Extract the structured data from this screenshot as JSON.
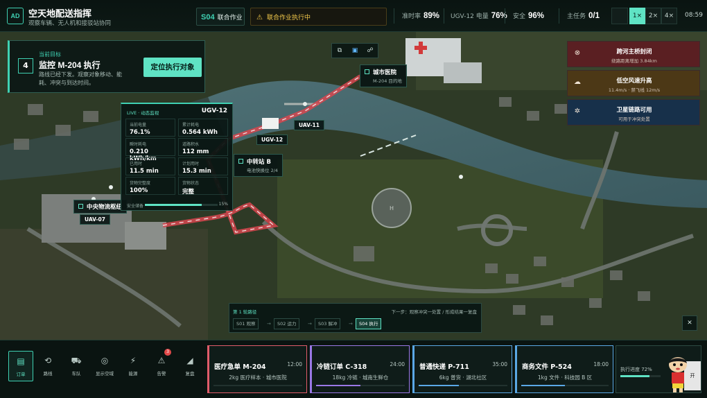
{
  "header": {
    "logo": "AD",
    "title": "空天地配送指挥",
    "subtitle": "观察车辆、无人机和接驳站协同",
    "stage_code": "S04",
    "stage_name": "联合作业",
    "alert_text": "联合作业执行中",
    "stats": [
      {
        "label": "准时率",
        "value": "89%"
      },
      {
        "label": "UGV-12 电量",
        "value": "76%"
      },
      {
        "label": "安全",
        "value": "96%"
      },
      {
        "label": "主任务",
        "value": "0/1"
      }
    ],
    "speeds": [
      "1×",
      "2×",
      "4×"
    ],
    "active_speed": "1×",
    "clock": "08:59"
  },
  "target": {
    "label": "当前目标",
    "number": "4",
    "title": "监控 M-204 执行",
    "desc": "路线已经下发。观察对象移动、能耗、冲突与到达时间。",
    "button": "定位执行对象"
  },
  "telemetry": {
    "live": "LIVE · 动态监视",
    "id": "UGV-12",
    "cells": [
      {
        "k": "当前电量",
        "v": "76.1%"
      },
      {
        "k": "累计耗电",
        "v": "0.564 kWh"
      },
      {
        "k": "瞬时耗电",
        "v": "0.210 kWh/km"
      },
      {
        "k": "道路积水",
        "v": "112 mm"
      },
      {
        "k": "已用时",
        "v": "11.5 min"
      },
      {
        "k": "计划用时",
        "v": "15.3 min"
      },
      {
        "k": "货物完整度",
        "v": "100%"
      },
      {
        "k": "货物状态",
        "v": "完整"
      }
    ],
    "safety_label": "安全储备",
    "safety_pct": "15%",
    "safety_fraction": 0.78
  },
  "map": {
    "hospital": {
      "title": "城市医院",
      "sub": "M-204 目的地"
    },
    "transfer": {
      "title": "中转站 B",
      "sub": "电池快换位 2/4"
    },
    "hub": {
      "title": "中央物流枢纽"
    },
    "tags": {
      "uav11": "UAV-11",
      "ugv12": "UGV-12",
      "uav07": "UAV-07"
    }
  },
  "alerts": [
    {
      "icon": "close-circle-icon",
      "title": "跨河主桥封闭",
      "sub": "绕路距离增加 3.84km",
      "color": "#5a1f22"
    },
    {
      "icon": "cloud-wind-icon",
      "title": "低空风速升高",
      "sub": "11.4m/s · 禁飞线 12m/s",
      "color": "#4c3816"
    },
    {
      "icon": "satellite-icon",
      "title": "卫星链路可用",
      "sub": "可用于冲突处置",
      "color": "#17304a"
    }
  ],
  "steps": {
    "head": "第 1 轮路径",
    "next": "下一步：观察冲突一处置 / 形成结果一复盘",
    "items": [
      "S01 观察",
      "S02 运力",
      "S03 解冲",
      "S04 执行"
    ],
    "active": 3
  },
  "nav": [
    {
      "label": "订单",
      "icon": "clipboard-icon",
      "glyph": "▤"
    },
    {
      "label": "路线",
      "icon": "route-icon",
      "glyph": "⟲"
    },
    {
      "label": "车队",
      "icon": "car-icon",
      "glyph": "⛟"
    },
    {
      "label": "显示空域",
      "icon": "radar-icon",
      "glyph": "◎"
    },
    {
      "label": "能源",
      "icon": "battery-icon",
      "glyph": "⚡"
    },
    {
      "label": "告警",
      "icon": "warning-icon",
      "glyph": "⚠"
    },
    {
      "label": "复盘",
      "icon": "chart-icon",
      "glyph": "◢"
    }
  ],
  "alert_badge": "3",
  "orders": [
    {
      "title": "医疗急单 M-204",
      "time": "12:00",
      "desc": "2kg 医疗样本 · 城市医院",
      "color": "#e05c6a",
      "progress": 0
    },
    {
      "title": "冷链订单 C-318",
      "time": "24:00",
      "desc": "18kg 冷链 · 城南生鲜仓",
      "color": "#9a78e6",
      "progress": 0.5
    },
    {
      "title": "普通快递 P-711",
      "time": "35:00",
      "desc": "6kg 普货 · 湖北社区",
      "color": "#5aa8e6",
      "progress": 0.45
    },
    {
      "title": "商务文件 P-524",
      "time": "18:00",
      "desc": "1kg 文件 · 科技园 B 区",
      "color": "#5aa8e6",
      "progress": 0.5
    }
  ],
  "exec_progress": {
    "label": "执行进度 72%",
    "fraction": 0.72,
    "button": "开"
  }
}
